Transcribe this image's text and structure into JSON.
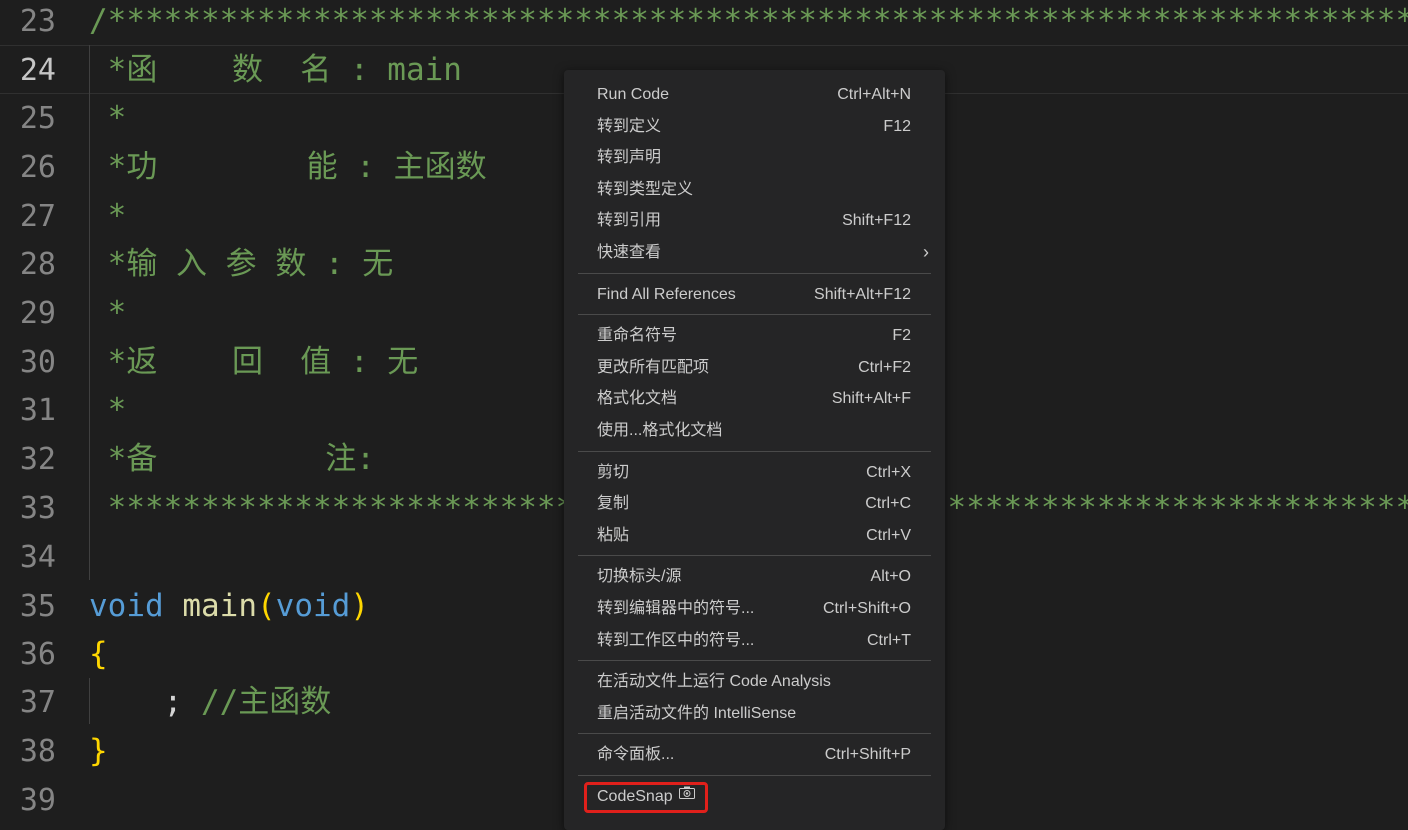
{
  "editor": {
    "lines": [
      {
        "num": "23",
        "tokens": [
          {
            "t": "/*************************************************************************************",
            "c": "comment"
          }
        ]
      },
      {
        "num": "24",
        "current": true,
        "tokens": [
          {
            "t": " *函    数  名 : main",
            "c": "comment"
          }
        ]
      },
      {
        "num": "25",
        "tokens": [
          {
            "t": " *",
            "c": "comment"
          }
        ]
      },
      {
        "num": "26",
        "tokens": [
          {
            "t": " *功        能 : 主函数",
            "c": "comment"
          }
        ]
      },
      {
        "num": "27",
        "tokens": [
          {
            "t": " *",
            "c": "comment"
          }
        ]
      },
      {
        "num": "28",
        "tokens": [
          {
            "t": " *输 入 参 数 : 无",
            "c": "comment"
          }
        ]
      },
      {
        "num": "29",
        "tokens": [
          {
            "t": " *",
            "c": "comment"
          }
        ]
      },
      {
        "num": "30",
        "tokens": [
          {
            "t": " *返    回  值 : 无",
            "c": "comment"
          }
        ]
      },
      {
        "num": "31",
        "tokens": [
          {
            "t": " *",
            "c": "comment"
          }
        ]
      },
      {
        "num": "32",
        "tokens": [
          {
            "t": " *备         注:",
            "c": "comment"
          }
        ]
      },
      {
        "num": "33",
        "tokens": [
          {
            "t": " **************************************************************************************",
            "c": "comment"
          }
        ]
      },
      {
        "num": "34",
        "tokens": []
      },
      {
        "num": "35",
        "tokens": [
          {
            "t": "void",
            "c": "keyword"
          },
          {
            "t": " ",
            "c": "punc"
          },
          {
            "t": "main",
            "c": "func"
          },
          {
            "t": "(",
            "c": "paren"
          },
          {
            "t": "void",
            "c": "keyword"
          },
          {
            "t": ")",
            "c": "paren"
          }
        ]
      },
      {
        "num": "36",
        "tokens": [
          {
            "t": "{",
            "c": "brace"
          }
        ]
      },
      {
        "num": "37",
        "tokens": [
          {
            "t": "    ; ",
            "c": "punc"
          },
          {
            "t": "//主函数",
            "c": "comment"
          }
        ]
      },
      {
        "num": "38",
        "tokens": [
          {
            "t": "}",
            "c": "brace"
          }
        ]
      },
      {
        "num": "39",
        "tokens": []
      }
    ]
  },
  "context_menu": {
    "groups": [
      [
        {
          "label": "Run Code",
          "shortcut": "Ctrl+Alt+N"
        },
        {
          "label": "转到定义",
          "shortcut": "F12"
        },
        {
          "label": "转到声明",
          "shortcut": ""
        },
        {
          "label": "转到类型定义",
          "shortcut": ""
        },
        {
          "label": "转到引用",
          "shortcut": "Shift+F12"
        },
        {
          "label": "快速查看",
          "shortcut": "",
          "submenu": true
        }
      ],
      [
        {
          "label": "Find All References",
          "shortcut": "Shift+Alt+F12"
        }
      ],
      [
        {
          "label": "重命名符号",
          "shortcut": "F2"
        },
        {
          "label": "更改所有匹配项",
          "shortcut": "Ctrl+F2"
        },
        {
          "label": "格式化文档",
          "shortcut": "Shift+Alt+F"
        },
        {
          "label": "使用...格式化文档",
          "shortcut": ""
        }
      ],
      [
        {
          "label": "剪切",
          "shortcut": "Ctrl+X"
        },
        {
          "label": "复制",
          "shortcut": "Ctrl+C"
        },
        {
          "label": "粘贴",
          "shortcut": "Ctrl+V"
        }
      ],
      [
        {
          "label": "切换标头/源",
          "shortcut": "Alt+O"
        },
        {
          "label": "转到编辑器中的符号...",
          "shortcut": "Ctrl+Shift+O"
        },
        {
          "label": "转到工作区中的符号...",
          "shortcut": "Ctrl+T"
        }
      ],
      [
        {
          "label": "在活动文件上运行 Code Analysis",
          "shortcut": ""
        },
        {
          "label": "重启活动文件的 IntelliSense",
          "shortcut": ""
        }
      ],
      [
        {
          "label": "命令面板...",
          "shortcut": "Ctrl+Shift+P"
        }
      ],
      [
        {
          "label": "CodeSnap",
          "shortcut": "",
          "icon": "camera-icon",
          "highlighted": true
        }
      ]
    ],
    "submenu_arrow": "›"
  },
  "colors": {
    "background": "#1e1e1e",
    "menu_background": "#252526",
    "highlight_border": "#e0201b",
    "comment": "#6a9955",
    "keyword": "#569cd6",
    "function": "#dcdcaa",
    "bracket": "#ffd700"
  }
}
